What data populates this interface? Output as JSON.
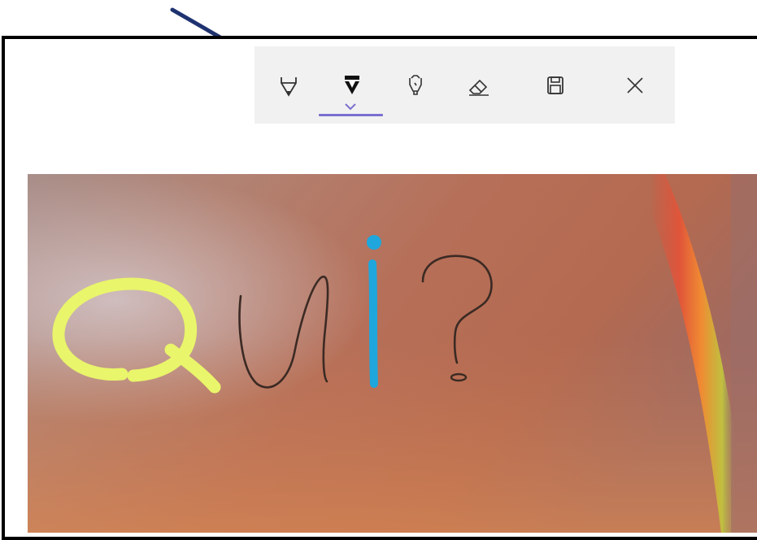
{
  "toolbar": {
    "tools": [
      {
        "id": "ballpoint-pen",
        "icon": "ballpoint-pen-icon",
        "selected": false
      },
      {
        "id": "pencil",
        "icon": "pencil-icon",
        "selected": true
      },
      {
        "id": "highlighter",
        "icon": "highlighter-icon",
        "selected": false
      },
      {
        "id": "eraser",
        "icon": "eraser-icon",
        "selected": false
      },
      {
        "id": "save",
        "icon": "save-icon",
        "selected": false
      },
      {
        "id": "close",
        "icon": "close-icon",
        "selected": false
      }
    ],
    "accent_color": "#7a6fd0",
    "background": "#f1f1f1"
  },
  "canvas": {
    "ink_strokes": [
      {
        "text": "Q",
        "color": "#e9f56a"
      },
      {
        "text": "u",
        "color": "#3b2a24"
      },
      {
        "text": "i",
        "color": "#1fa6dc"
      },
      {
        "text": "?",
        "color": "#3b2a24"
      }
    ],
    "background_colors": [
      "#9c8a86",
      "#b07060",
      "#c8784c",
      "#e8a070"
    ]
  },
  "annotation": {
    "arrow_color": "#1f3270"
  }
}
